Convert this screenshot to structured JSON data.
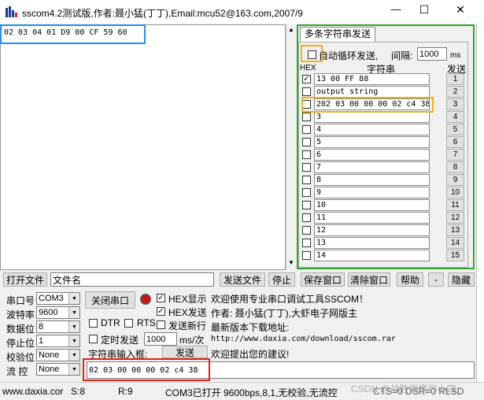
{
  "window": {
    "title": "sscom4.2测试版,作者:聂小猛(丁丁),Email:mcu52@163.com,2007/9",
    "minimize": "—",
    "maximize": "☐",
    "close": "✕"
  },
  "receive": {
    "text": "02 03 04 01 D9 00 CF 59 60"
  },
  "multi": {
    "tab_label": "多条字符串发送",
    "auto_loop_label": "自动循环发送,",
    "interval_label": "间隔:",
    "interval_value": "1000",
    "interval_unit": "ms",
    "hdr_hex": "HEX",
    "hdr_string": "字符串",
    "hdr_send": "发送",
    "rows": [
      {
        "checked": "✓",
        "value": "13 00 FF 88",
        "btn": "1"
      },
      {
        "checked": "",
        "value": "output string",
        "btn": "2"
      },
      {
        "checked": "",
        "value": "202 03 00 00 00 02 c4 38",
        "btn": "3"
      },
      {
        "checked": "",
        "value": "3",
        "btn": "4"
      },
      {
        "checked": "",
        "value": "4",
        "btn": "5"
      },
      {
        "checked": "",
        "value": "5",
        "btn": "6"
      },
      {
        "checked": "",
        "value": "6",
        "btn": "7"
      },
      {
        "checked": "",
        "value": "7",
        "btn": "8"
      },
      {
        "checked": "",
        "value": "8",
        "btn": "9"
      },
      {
        "checked": "",
        "value": "9",
        "btn": "10"
      },
      {
        "checked": "",
        "value": "10",
        "btn": "11"
      },
      {
        "checked": "",
        "value": "11",
        "btn": "12"
      },
      {
        "checked": "",
        "value": "12",
        "btn": "13"
      },
      {
        "checked": "",
        "value": "13",
        "btn": "14"
      },
      {
        "checked": "",
        "value": "14",
        "btn": "15"
      }
    ]
  },
  "toolbar": {
    "open_file": "打开文件",
    "file_name": "文件名",
    "send_file": "发送文件",
    "stop": "停止",
    "save_window": "保存窗口",
    "clear_window": "清除窗口",
    "help": "帮助",
    "minus": "-",
    "hide": "隐藏"
  },
  "port": {
    "port_label": "串口号",
    "port_value": "COM3",
    "baud_label": "波特率",
    "baud_value": "9600",
    "data_label": "数据位",
    "data_value": "8",
    "stop_label": "停止位",
    "stop_value": "1",
    "parity_label": "校验位",
    "parity_value": "None",
    "flow_label": "流 控",
    "flow_value": "None",
    "close_port": "关闭串口",
    "hex_display": "HEX显示",
    "hex_send": "HEX发送",
    "send_newline": "发送新行",
    "dtr": "DTR",
    "rts": "RTS",
    "timed_send": "定时发送",
    "timed_value": "1000",
    "timed_unit": "ms/次",
    "string_input_label": "字符串输入框:",
    "send_button": "发送",
    "send_input": "02 03 00 00 00 02 c4 38"
  },
  "info": {
    "line1": "欢迎使用专业串口调试工具SSCOM！",
    "line2": "作者: 聂小猛(丁丁),大虾电子网版主",
    "line3": "最新版本下载地址:",
    "line4": "http://www.daxia.com/download/sscom.rar",
    "line5": "欢迎提出您的建议!"
  },
  "status": {
    "url": "www.daxia.cor",
    "s": "S:8",
    "r": "R:9",
    "com": "COM3已打开  9600bps,8,1,无校验,无流控",
    "cts": "CTS=0 DSR=0 RLSD",
    "watermark": "CSDN @战胜懒惰的小四"
  },
  "colors": {
    "highlight_red": "#e0201a",
    "highlight_blue": "#2a8ee8",
    "highlight_green": "#2eaa2e",
    "highlight_orange": "#f0b020"
  }
}
